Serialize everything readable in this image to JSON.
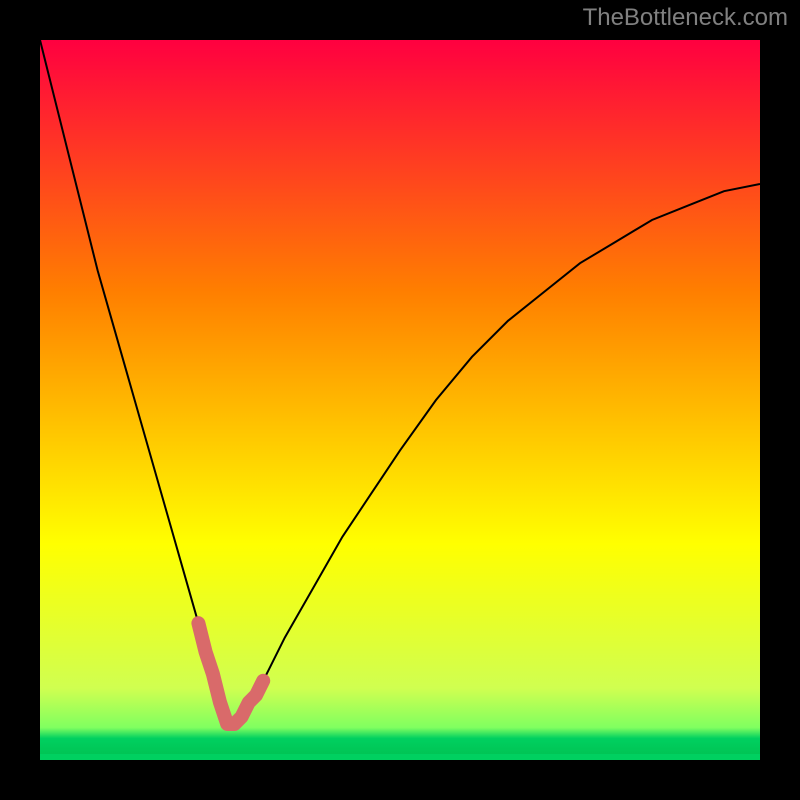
{
  "watermark": "TheBottleneck.com",
  "chart_data": {
    "type": "line",
    "title": "",
    "xlabel": "",
    "ylabel": "",
    "xlim": [
      0,
      100
    ],
    "ylim": [
      0,
      100
    ],
    "background_gradient": {
      "top": "#ff0040",
      "mid1": "#ff7f00",
      "mid2": "#ffff00",
      "low": "#d0ff50",
      "bottom": "#00d060"
    },
    "series": [
      {
        "name": "bottleneck-curve",
        "stroke": "#000000",
        "stroke_width": 2,
        "x": [
          0,
          2,
          4,
          6,
          8,
          10,
          12,
          14,
          16,
          18,
          20,
          22,
          24,
          25,
          26,
          27,
          28,
          30,
          32,
          34,
          38,
          42,
          46,
          50,
          55,
          60,
          65,
          70,
          75,
          80,
          85,
          90,
          95,
          100
        ],
        "y": [
          100,
          92,
          84,
          76,
          68,
          61,
          54,
          47,
          40,
          33,
          26,
          19,
          12,
          8,
          5,
          5,
          6,
          9,
          13,
          17,
          24,
          31,
          37,
          43,
          50,
          56,
          61,
          65,
          69,
          72,
          75,
          77,
          79,
          80
        ]
      },
      {
        "name": "highlight-minimum",
        "stroke": "#d96a6a",
        "stroke_width": 14,
        "linecap": "round",
        "x": [
          22,
          23,
          24,
          25,
          26,
          27,
          28,
          29,
          30,
          31
        ],
        "y": [
          19,
          15,
          12,
          8,
          5,
          5,
          6,
          8,
          9,
          11
        ]
      }
    ]
  }
}
